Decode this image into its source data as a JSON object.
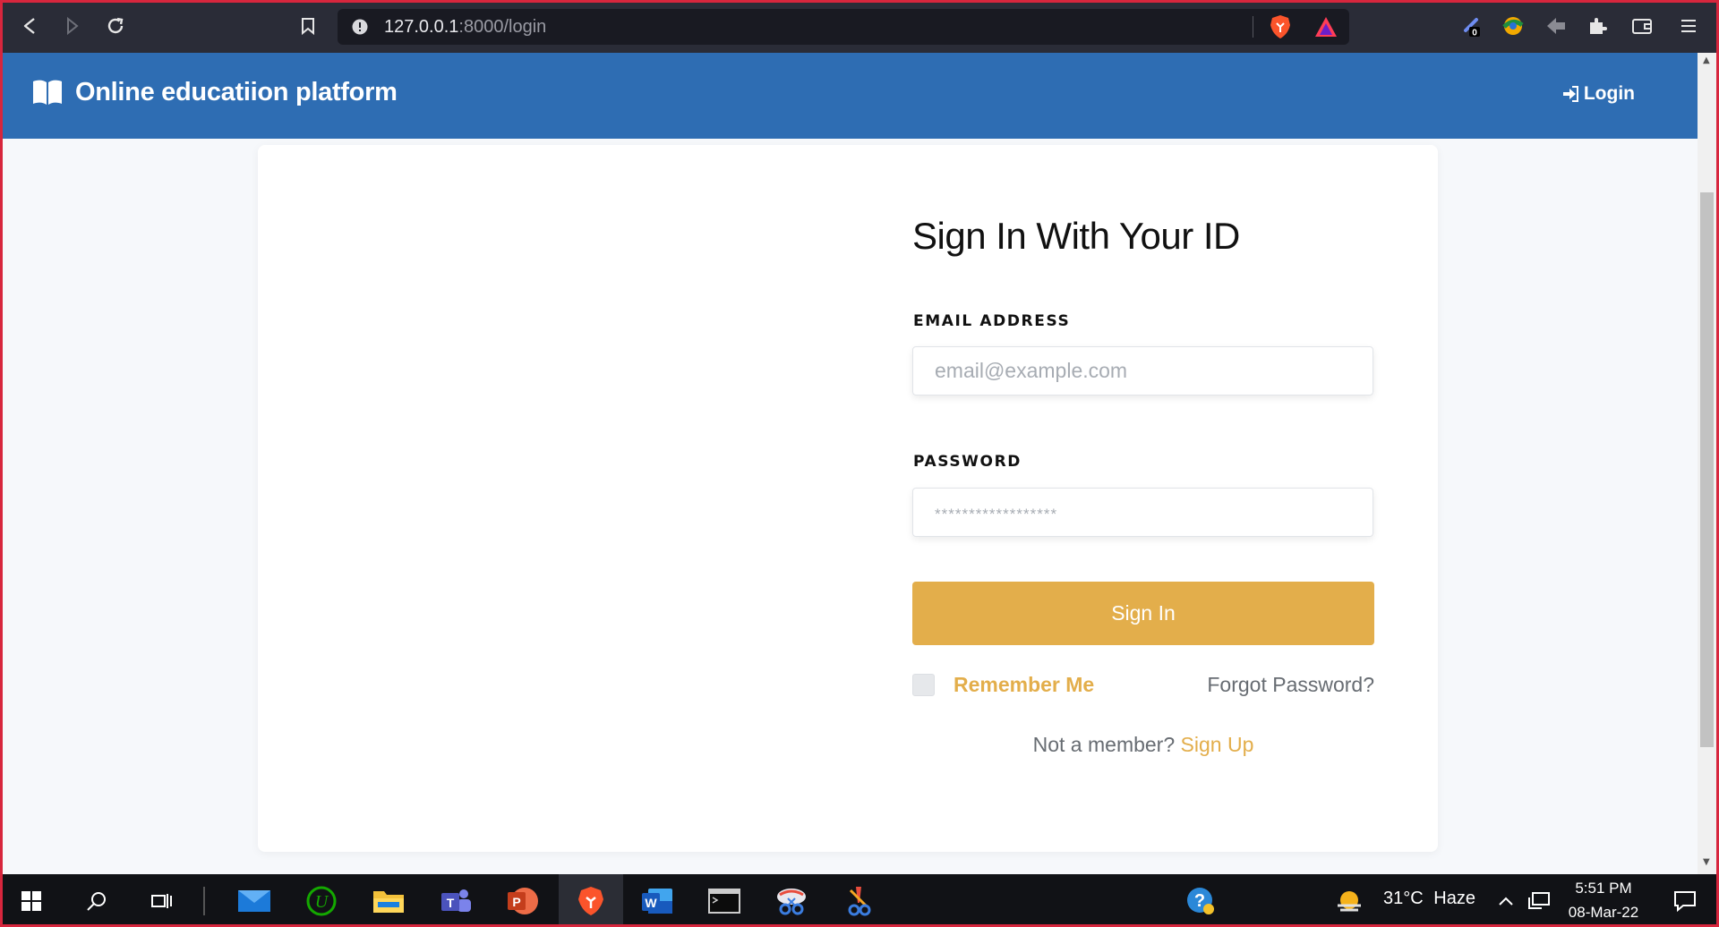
{
  "browser": {
    "url_host": "127.0.0.1",
    "url_path": ":8000/login",
    "extension_badge": "0"
  },
  "navbar": {
    "brand_title": "Online educatiion platform",
    "login_label": "Login"
  },
  "form": {
    "title": "Sign In With Your ID",
    "email_label": "EMAIL ADDRESS",
    "email_placeholder": "email@example.com",
    "email_value": "",
    "password_label": "PASSWORD",
    "password_placeholder": "******************",
    "password_value": "",
    "submit_label": "Sign In",
    "remember_label": "Remember Me",
    "remember_checked": false,
    "forgot_label": "Forgot Password?",
    "member_prompt": "Not a member?",
    "signup_label": "Sign Up"
  },
  "taskbar": {
    "weather_temp": "31°C",
    "weather_desc": "Haze",
    "time": "5:51 PM",
    "date": "08-Mar-22",
    "apps": [
      "start",
      "search",
      "task-view",
      "mail",
      "upwork",
      "file-explorer",
      "teams",
      "powerpoint",
      "brave",
      "word",
      "terminal",
      "snipping-tool",
      "paint"
    ]
  },
  "colors": {
    "navbar": "#2e6db3",
    "accent": "#e3ae4b",
    "card_bg": "#ffffff",
    "page_bg": "#f6f8fb"
  }
}
